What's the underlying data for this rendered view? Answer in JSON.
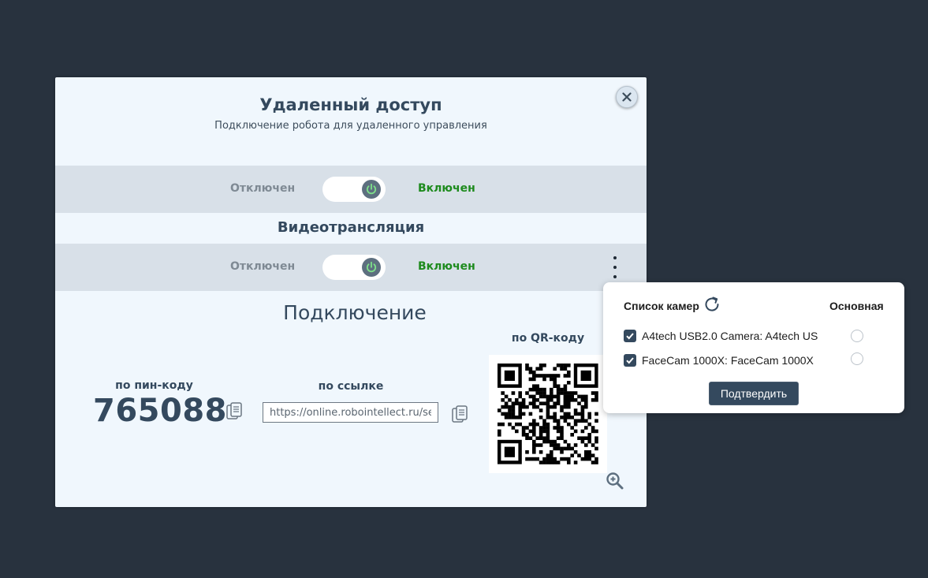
{
  "modal": {
    "title": "Удаленный доступ",
    "subtitle": "Подключение робота для удаленного управления",
    "remote_toggle": {
      "off_label": "Отключен",
      "on_label": "Включен",
      "state": "on"
    },
    "video_section_title": "Видеотрансляция",
    "video_toggle": {
      "off_label": "Отключен",
      "on_label": "Включен",
      "state": "on"
    },
    "connection": {
      "title": "Подключение",
      "pin_label": "по пин-коду",
      "pin_value": "765088",
      "link_label": "по ссылке",
      "link_value": "https://online.robointellect.ru/se",
      "qr_label": "по QR-коду"
    }
  },
  "camera_popup": {
    "header": "Список камер",
    "main_header": "Основная",
    "cameras": [
      {
        "name": "A4tech USB2.0 Camera: A4tech US",
        "checked": true,
        "primary": false
      },
      {
        "name": "FaceCam 1000X: FaceCam 1000X",
        "checked": true,
        "primary": false
      }
    ],
    "confirm_label": "Подтвердить"
  },
  "colors": {
    "page_bg": "#28323e",
    "modal_bg": "#f0f7fd",
    "band_bg": "#d8e0e8",
    "primary": "#34495e",
    "on_green": "#1e8b1e",
    "power_green": "#7ee08a"
  },
  "icons": {
    "close": "close-icon",
    "power": "power-icon",
    "kebab": "more-vertical-icon",
    "copy": "copy-icon",
    "zoom": "zoom-in-icon",
    "refresh": "refresh-icon",
    "check": "check-icon"
  }
}
